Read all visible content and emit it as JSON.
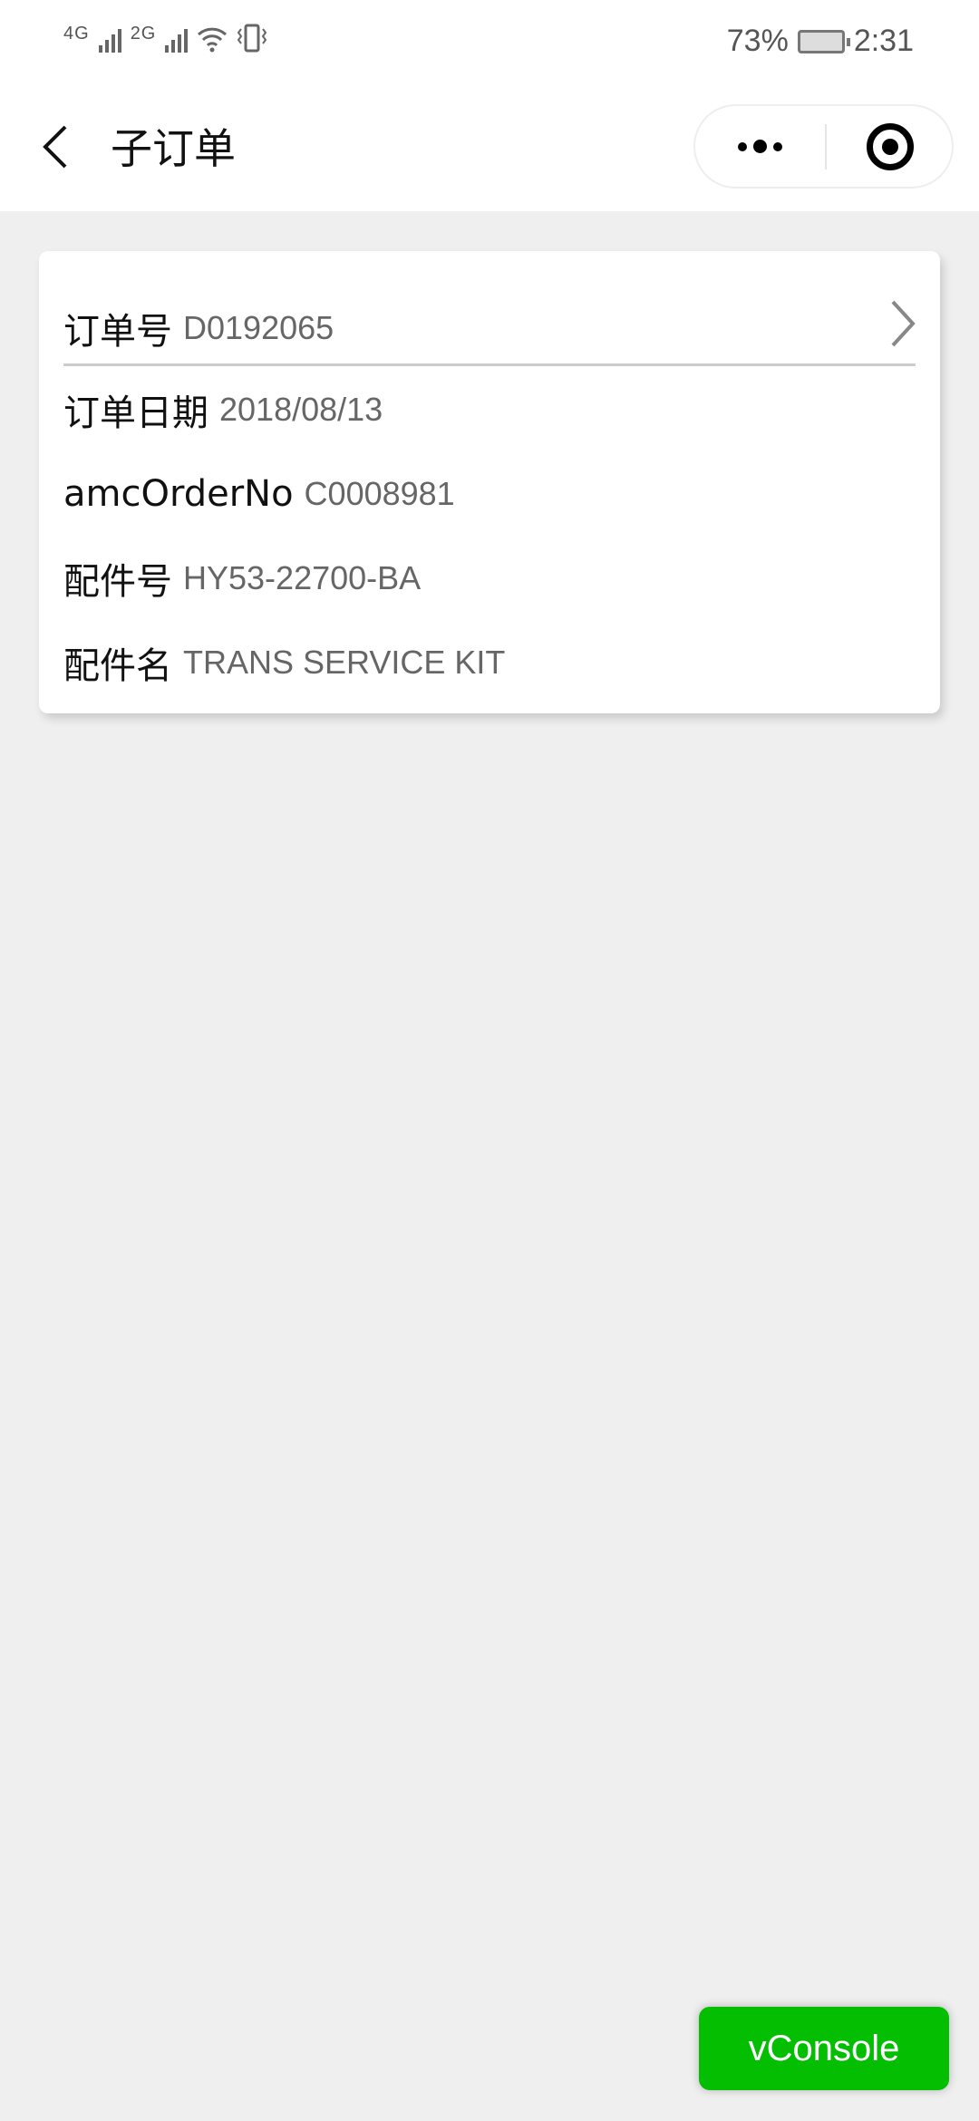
{
  "status_bar": {
    "net1": "4G",
    "net2": "2G",
    "battery": "73%",
    "time": "2:31"
  },
  "nav": {
    "title": "子订单"
  },
  "order": {
    "rows": [
      {
        "label": "订单号",
        "value": "D0192065"
      },
      {
        "label": "订单日期",
        "value": "2018/08/13"
      },
      {
        "label": "amcOrderNo",
        "value": "C0008981"
      },
      {
        "label": "配件号",
        "value": "HY53-22700-BA"
      },
      {
        "label": "配件名",
        "value": "TRANS SERVICE KIT"
      }
    ]
  },
  "vconsole": {
    "label": "vConsole"
  },
  "colors": {
    "accent": "#04be02",
    "background": "#efefef"
  }
}
